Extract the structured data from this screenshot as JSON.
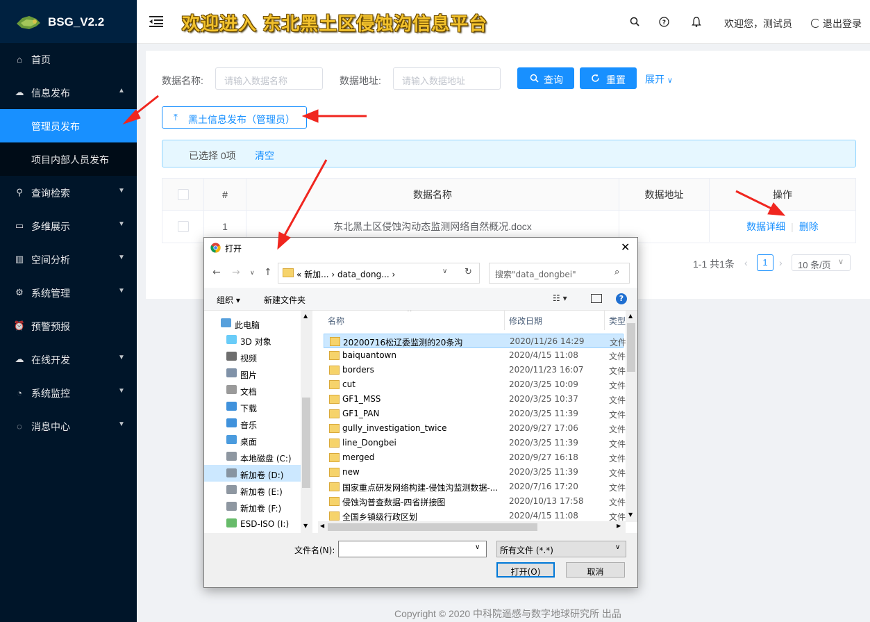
{
  "app": {
    "name": "BSG_V2.2",
    "banner": "欢迎进入 东北黑土区侵蚀沟信息平台"
  },
  "sidebar": {
    "items": [
      {
        "label": "首页",
        "icon": "home-icon",
        "arrow": ""
      },
      {
        "label": "信息发布",
        "icon": "cloud-icon",
        "arrow": "▲"
      },
      {
        "label": "管理员发布",
        "sub": true,
        "active": true
      },
      {
        "label": "项目内部人员发布",
        "sub": true
      },
      {
        "label": "查询检索",
        "icon": "search-icon",
        "arrow": "▼"
      },
      {
        "label": "多维展示",
        "icon": "desktop-icon",
        "arrow": "▼"
      },
      {
        "label": "空间分析",
        "icon": "bar-chart-icon",
        "arrow": "▼"
      },
      {
        "label": "系统管理",
        "icon": "gear-icon",
        "arrow": "▼"
      },
      {
        "label": "预警预报",
        "icon": "alarm-icon",
        "arrow": ""
      },
      {
        "label": "在线开发",
        "icon": "cloud-icon",
        "arrow": "▼"
      },
      {
        "label": "系统监控",
        "icon": "dashboard-icon",
        "arrow": "▼"
      },
      {
        "label": "消息中心",
        "icon": "message-icon",
        "arrow": "▼"
      }
    ]
  },
  "header": {
    "welcome": "欢迎您，测试员",
    "logout": "退出登录"
  },
  "filter": {
    "name_label": "数据名称:",
    "name_placeholder": "请输入数据名称",
    "addr_label": "数据地址:",
    "addr_placeholder": "请输入数据地址",
    "query": "查询",
    "reset": "重置",
    "expand": "展开"
  },
  "publish_button": "黑土信息发布（管理员）",
  "alert": {
    "selected": "已选择 0项",
    "clear": "清空"
  },
  "table": {
    "headers": [
      "#",
      "数据名称",
      "数据地址",
      "操作"
    ],
    "rows": [
      {
        "index": "1",
        "name": "东北黑土区侵蚀沟动态监测网络自然概况.docx",
        "addr": "",
        "detail": "数据详细",
        "delete": "删除"
      }
    ]
  },
  "pager": {
    "total": "1-1 共1条",
    "current": "1",
    "size": "10 条/页"
  },
  "footer": "Copyright © 2020 中科院遥感与数字地球研究所 出品",
  "dialog": {
    "title": "打开",
    "path": "« 新加... › data_dong... ›",
    "search_placeholder": "搜索\"data_dongbei\"",
    "organize": "组织 ▾",
    "new_folder": "新建文件夹",
    "col_name": "名称",
    "col_date": "修改日期",
    "col_type": "类型",
    "tree": [
      {
        "label": "此电脑",
        "icon": "computer-icon"
      },
      {
        "label": "3D 对象",
        "icon": "3d-objects-icon"
      },
      {
        "label": "视频",
        "icon": "video-icon"
      },
      {
        "label": "图片",
        "icon": "pictures-icon"
      },
      {
        "label": "文档",
        "icon": "documents-icon"
      },
      {
        "label": "下载",
        "icon": "download-icon"
      },
      {
        "label": "音乐",
        "icon": "music-icon"
      },
      {
        "label": "桌面",
        "icon": "desktop-icon"
      },
      {
        "label": "本地磁盘 (C:)",
        "icon": "drive-icon"
      },
      {
        "label": "新加卷 (D:)",
        "icon": "drive-icon",
        "selected": true
      },
      {
        "label": "新加卷 (E:)",
        "icon": "drive-icon"
      },
      {
        "label": "新加卷 (F:)",
        "icon": "drive-icon"
      },
      {
        "label": "ESD-ISO (I:)",
        "icon": "disc-icon"
      }
    ],
    "files": [
      {
        "name": "20200716松辽委监测的20条沟",
        "date": "2020/11/26 14:29",
        "type": "文件",
        "selected": true
      },
      {
        "name": "baiquantown",
        "date": "2020/4/15 11:08",
        "type": "文件"
      },
      {
        "name": "borders",
        "date": "2020/11/23 16:07",
        "type": "文件"
      },
      {
        "name": "cut",
        "date": "2020/3/25 10:09",
        "type": "文件"
      },
      {
        "name": "GF1_MSS",
        "date": "2020/3/25 10:37",
        "type": "文件"
      },
      {
        "name": "GF1_PAN",
        "date": "2020/3/25 11:39",
        "type": "文件"
      },
      {
        "name": "gully_investigation_twice",
        "date": "2020/9/27 17:06",
        "type": "文件"
      },
      {
        "name": "line_Dongbei",
        "date": "2020/3/25 11:39",
        "type": "文件"
      },
      {
        "name": "merged",
        "date": "2020/9/27 16:18",
        "type": "文件"
      },
      {
        "name": "new",
        "date": "2020/3/25 11:39",
        "type": "文件"
      },
      {
        "name": "国家重点研发网络构建-侵蚀沟监测数据-...",
        "date": "2020/7/16 17:20",
        "type": "文件"
      },
      {
        "name": "侵蚀沟普查数据-四省拼接图",
        "date": "2020/10/13 17:58",
        "type": "文件"
      },
      {
        "name": "全国乡镇级行政区划",
        "date": "2020/4/15 11:08",
        "type": "文件"
      }
    ],
    "filename_label": "文件名(N):",
    "filetype": "所有文件 (*.*)",
    "open": "打开(O)",
    "cancel": "取消"
  },
  "colors": {
    "sidebar": "#001529",
    "primary": "#1890ff",
    "arrow": "#f0261f"
  }
}
